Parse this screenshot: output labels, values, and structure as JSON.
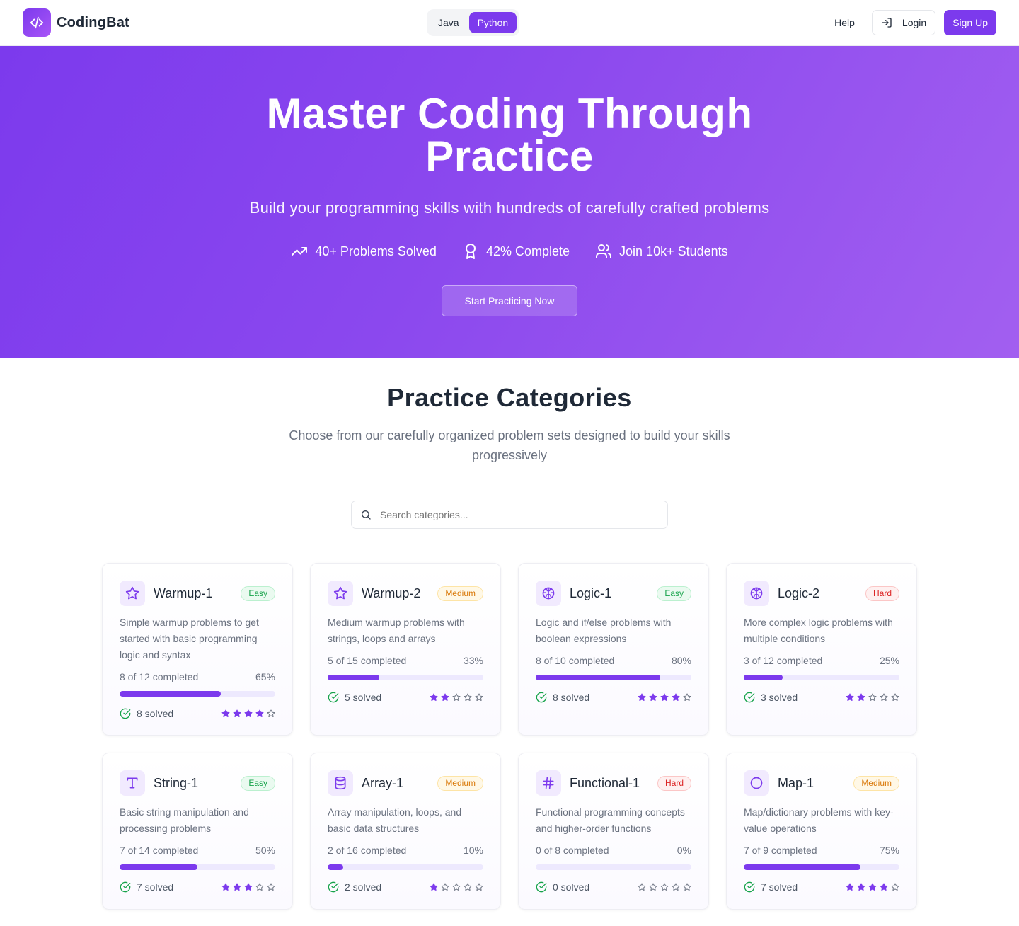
{
  "brand": {
    "name": "CodingBat"
  },
  "header": {
    "languages": [
      {
        "label": "Java",
        "active": false
      },
      {
        "label": "Python",
        "active": true
      }
    ],
    "help_label": "Help",
    "login_label": "Login",
    "signup_label": "Sign Up"
  },
  "hero": {
    "title": "Master Coding Through Practice",
    "subtitle": "Build your programming skills with hundreds of carefully crafted problems",
    "stats": [
      {
        "icon": "trending-up-icon",
        "label": "40+ Problems Solved"
      },
      {
        "icon": "award-icon",
        "label": "42% Complete"
      },
      {
        "icon": "users-icon",
        "label": "Join 10k+ Students"
      }
    ],
    "cta_label": "Start Practicing Now"
  },
  "categories": {
    "title": "Practice Categories",
    "subtitle": "Choose from our carefully organized problem sets designed to build your skills progressively",
    "search_placeholder": "Search categories...",
    "items": [
      {
        "name": "Warmup-1",
        "icon": "star-icon",
        "difficulty": "Easy",
        "description": "Simple warmup problems to get started with basic programming logic and syntax",
        "completed_text": "8 of 12 completed",
        "percent_text": "65%",
        "progress": 65,
        "solved_text": "8 solved",
        "stars": 4
      },
      {
        "name": "Warmup-2",
        "icon": "star-icon",
        "difficulty": "Medium",
        "description": "Medium warmup problems with strings, loops and arrays",
        "completed_text": "5 of 15 completed",
        "percent_text": "33%",
        "progress": 33,
        "solved_text": "5 solved",
        "stars": 2
      },
      {
        "name": "Logic-1",
        "icon": "brain-icon",
        "difficulty": "Easy",
        "description": "Logic and if/else problems with boolean expressions",
        "completed_text": "8 of 10 completed",
        "percent_text": "80%",
        "progress": 80,
        "solved_text": "8 solved",
        "stars": 4
      },
      {
        "name": "Logic-2",
        "icon": "brain-icon",
        "difficulty": "Hard",
        "description": "More complex logic problems with multiple conditions",
        "completed_text": "3 of 12 completed",
        "percent_text": "25%",
        "progress": 25,
        "solved_text": "3 solved",
        "stars": 2
      },
      {
        "name": "String-1",
        "icon": "type-icon",
        "difficulty": "Easy",
        "description": "Basic string manipulation and processing problems",
        "completed_text": "7 of 14 completed",
        "percent_text": "50%",
        "progress": 50,
        "solved_text": "7 solved",
        "stars": 3
      },
      {
        "name": "Array-1",
        "icon": "database-icon",
        "difficulty": "Medium",
        "description": "Array manipulation, loops, and basic data structures",
        "completed_text": "2 of 16 completed",
        "percent_text": "10%",
        "progress": 10,
        "solved_text": "2 solved",
        "stars": 1
      },
      {
        "name": "Functional-1",
        "icon": "hash-icon",
        "difficulty": "Hard",
        "description": "Functional programming concepts and higher-order functions",
        "completed_text": "0 of 8 completed",
        "percent_text": "0%",
        "progress": 0,
        "solved_text": "0 solved",
        "stars": 0
      },
      {
        "name": "Map-1",
        "icon": "circle-icon",
        "difficulty": "Medium",
        "description": "Map/dictionary problems with key-value operations",
        "completed_text": "7 of 9 completed",
        "percent_text": "75%",
        "progress": 75,
        "solved_text": "7 solved",
        "stars": 4
      }
    ]
  },
  "colors": {
    "accent": "#7c3aed",
    "success": "#16a34a",
    "warning": "#d97706",
    "danger": "#dc2626"
  }
}
